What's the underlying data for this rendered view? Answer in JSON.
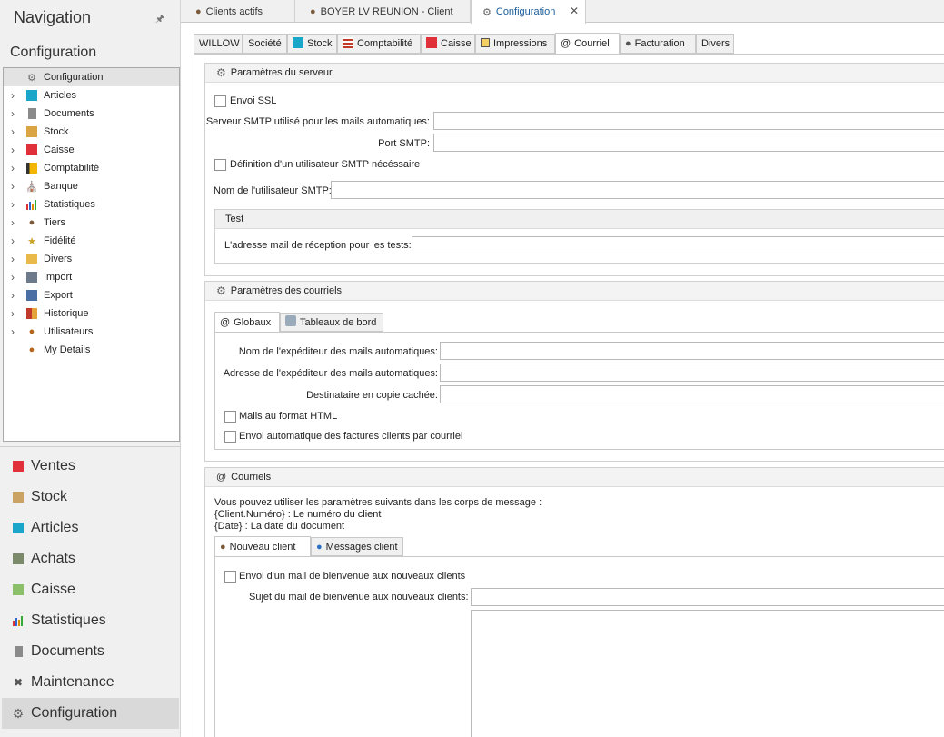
{
  "navigation": {
    "title": "Navigation",
    "pin_icon": "pin-icon",
    "subtitle": "Configuration",
    "tree": [
      {
        "label": "Configuration",
        "icon": "gear-icon",
        "expandable": false,
        "selected": true
      },
      {
        "label": "Articles",
        "icon": "articles-icon",
        "expandable": true
      },
      {
        "label": "Documents",
        "icon": "documents-icon",
        "expandable": true
      },
      {
        "label": "Stock",
        "icon": "stock-icon",
        "expandable": true
      },
      {
        "label": "Caisse",
        "icon": "caisse-icon",
        "expandable": true
      },
      {
        "label": "Comptabilité",
        "icon": "comptabilite-icon",
        "expandable": true
      },
      {
        "label": "Banque",
        "icon": "bank-icon",
        "expandable": true
      },
      {
        "label": "Statistiques",
        "icon": "statistics-icon",
        "expandable": true
      },
      {
        "label": "Tiers",
        "icon": "person-icon",
        "expandable": true
      },
      {
        "label": "Fidélité",
        "icon": "trophy-icon",
        "expandable": true
      },
      {
        "label": "Divers",
        "icon": "folder-icon",
        "expandable": true
      },
      {
        "label": "Import",
        "icon": "import-icon",
        "expandable": true
      },
      {
        "label": "Export",
        "icon": "export-icon",
        "expandable": true
      },
      {
        "label": "Historique",
        "icon": "history-icon",
        "expandable": true
      },
      {
        "label": "Utilisateurs",
        "icon": "users-icon",
        "expandable": true
      },
      {
        "label": "My Details",
        "icon": "user-details-icon",
        "expandable": false
      }
    ],
    "modules": [
      {
        "label": "Ventes",
        "icon": "ventes-icon"
      },
      {
        "label": "Stock",
        "icon": "stock-icon"
      },
      {
        "label": "Articles",
        "icon": "articles-icon"
      },
      {
        "label": "Achats",
        "icon": "achats-icon"
      },
      {
        "label": "Caisse",
        "icon": "caisse-icon"
      },
      {
        "label": "Statistiques",
        "icon": "statistics-icon"
      },
      {
        "label": "Documents",
        "icon": "documents-icon"
      },
      {
        "label": "Maintenance",
        "icon": "tools-icon"
      },
      {
        "label": "Configuration",
        "icon": "gear-icon",
        "selected": true
      }
    ]
  },
  "doc_tabs": [
    {
      "label": "Clients actifs",
      "icon": "person-icon"
    },
    {
      "label": "BOYER LV REUNION - Client",
      "icon": "person-icon"
    },
    {
      "label": "Configuration",
      "icon": "gear-icon",
      "active": true,
      "closable": true
    }
  ],
  "config_tabs": [
    {
      "label": "WILLOW"
    },
    {
      "label": "Société"
    },
    {
      "label": "Stock",
      "icon": "stock-icon"
    },
    {
      "label": "Comptabilité",
      "icon": "comptabilite-icon"
    },
    {
      "label": "Caisse",
      "icon": "caisse-icon"
    },
    {
      "label": "Impressions",
      "icon": "print-icon"
    },
    {
      "label": "Courriel",
      "icon": "at-icon",
      "active": true
    },
    {
      "label": "Facturation",
      "icon": "invoice-icon"
    },
    {
      "label": "Divers"
    }
  ],
  "server": {
    "header": "Paramètres du serveur",
    "ssl_label": "Envoi SSL",
    "smtp_server_label": "Serveur SMTP utilisé pour les mails automatiques:",
    "smtp_server_value": "",
    "smtp_port_label": "Port SMTP:",
    "smtp_port_value": "",
    "smtp_user_required_label": "Définition d'un utilisateur SMTP nécéssaire",
    "smtp_user_label": "Nom de l'utilisateur SMTP:",
    "smtp_user_value": "",
    "test_header": "Test",
    "test_email_label": "L'adresse mail de réception pour les tests:",
    "test_email_value": ""
  },
  "emails_params": {
    "header": "Paramètres des courriels",
    "tabs": [
      {
        "label": "Globaux",
        "icon": "at-icon",
        "active": true
      },
      {
        "label": "Tableaux de bord",
        "icon": "dashboard-icon"
      }
    ],
    "sender_name_label": "Nom de l'expéditeur des mails automatiques:",
    "sender_address_label": "Adresse de l'expéditeur des mails automatiques:",
    "bcc_label": "Destinataire en copie cachée:",
    "html_format_label": "Mails au format HTML",
    "auto_invoice_label": "Envoi automatique des factures clients par courriel"
  },
  "emails": {
    "header": "Courriels",
    "intro": "Vous pouvez utiliser les paramètres suivants dans les corps de message :",
    "param_1": "{Client.Numéro} : Le numéro du client",
    "param_2": "{Date} : La date du document",
    "tabs": [
      {
        "label": "Nouveau client",
        "icon": "person-icon",
        "active": true
      },
      {
        "label": "Messages client",
        "icon": "message-icon"
      }
    ],
    "welcome_mail_label": "Envoi d'un mail de bienvenue aux nouveaux clients",
    "welcome_subject_label": "Sujet du mail de bienvenue aux nouveaux clients:",
    "welcome_subject_value": "",
    "welcome_body_value": ""
  },
  "colors": {
    "accent_blue": "#1b5d9b",
    "panel_bg": "#f0f0f0"
  }
}
